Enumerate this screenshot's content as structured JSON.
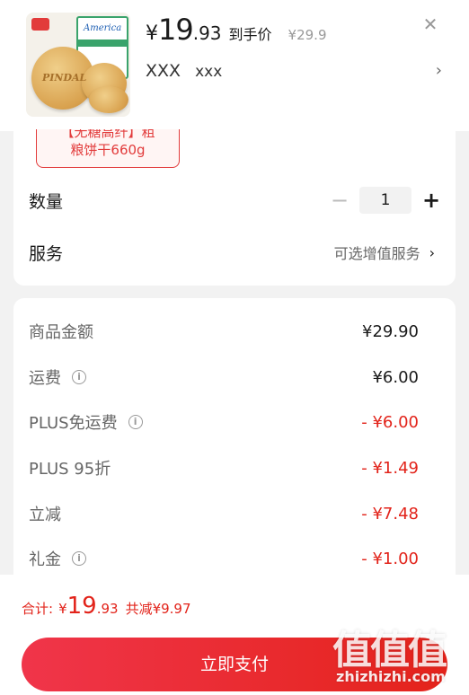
{
  "header": {
    "currency": "¥",
    "price_int": "19",
    "price_dec": ".93",
    "price_tag": "到手价",
    "original_price": "¥29.9",
    "close_icon": "close-icon",
    "spec_primary": "XXX",
    "spec_secondary": "xxx",
    "spec_arrow": "›",
    "thumb_brand": "America",
    "thumb_cookie_text": "PINDAL"
  },
  "product_chip": {
    "line1": "【无糖高纤】粗",
    "line2": "粮饼干660g"
  },
  "quantity": {
    "label": "数量",
    "minus": "−",
    "value": "1",
    "plus": "+"
  },
  "service": {
    "label": "服务",
    "value": "可选增值服务",
    "arrow": "›"
  },
  "fees": [
    {
      "label": "商品金额",
      "value": "¥29.90",
      "info": false,
      "red": false
    },
    {
      "label": "运费",
      "value": "¥6.00",
      "info": true,
      "red": false
    },
    {
      "label": "PLUS免运费",
      "value": "- ¥6.00",
      "info": true,
      "red": true
    },
    {
      "label": "PLUS 95折",
      "value": "- ¥1.49",
      "info": false,
      "red": true
    },
    {
      "label": "立减",
      "value": "- ¥7.48",
      "info": false,
      "red": true
    },
    {
      "label": "礼金",
      "value": "- ¥1.00",
      "info": true,
      "red": true
    }
  ],
  "total": {
    "label": "合计:",
    "currency": "¥",
    "int": "19",
    "dec": ".93",
    "reduced": "共减¥9.97"
  },
  "pay_button": "立即支付",
  "watermark": {
    "big": "值值值",
    "url": "zhizhizhi.com"
  },
  "colors": {
    "accent": "#e2231a",
    "pay_gradient_start": "#f0354a",
    "pay_gradient_end": "#e4231b"
  }
}
